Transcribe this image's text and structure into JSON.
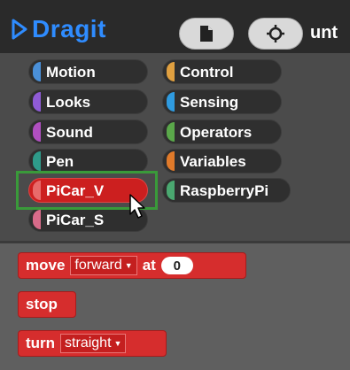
{
  "app": {
    "name": "Dragit",
    "file_title": "unt"
  },
  "toolbar": {
    "new_icon": "file-icon",
    "settings_icon": "gear-icon"
  },
  "categories": [
    {
      "label": "Motion",
      "color": "#4a90d9"
    },
    {
      "label": "Control",
      "color": "#e0a040"
    },
    {
      "label": "Looks",
      "color": "#8f5bd6"
    },
    {
      "label": "Sensing",
      "color": "#2f9be0"
    },
    {
      "label": "Sound",
      "color": "#b04fc0"
    },
    {
      "label": "Operators",
      "color": "#5aa84a"
    },
    {
      "label": "Pen",
      "color": "#2e9b8a"
    },
    {
      "label": "Variables",
      "color": "#e07a2a"
    },
    {
      "label": "PiCar_V",
      "color": "#e86a6a"
    },
    {
      "label": "RaspberryPi",
      "color": "#4aa870"
    },
    {
      "label": "PiCar_S",
      "color": "#d86b8a"
    }
  ],
  "selected_category": "PiCar_V",
  "blocks": {
    "move": {
      "keyword": "move",
      "direction": "forward",
      "at_label": "at",
      "value": "0"
    },
    "stop": {
      "keyword": "stop"
    },
    "turn": {
      "keyword": "turn",
      "direction": "straight"
    }
  },
  "colors": {
    "brand": "#2f8cff",
    "block": "#d62d2d",
    "highlight": "#3a9a3a"
  }
}
